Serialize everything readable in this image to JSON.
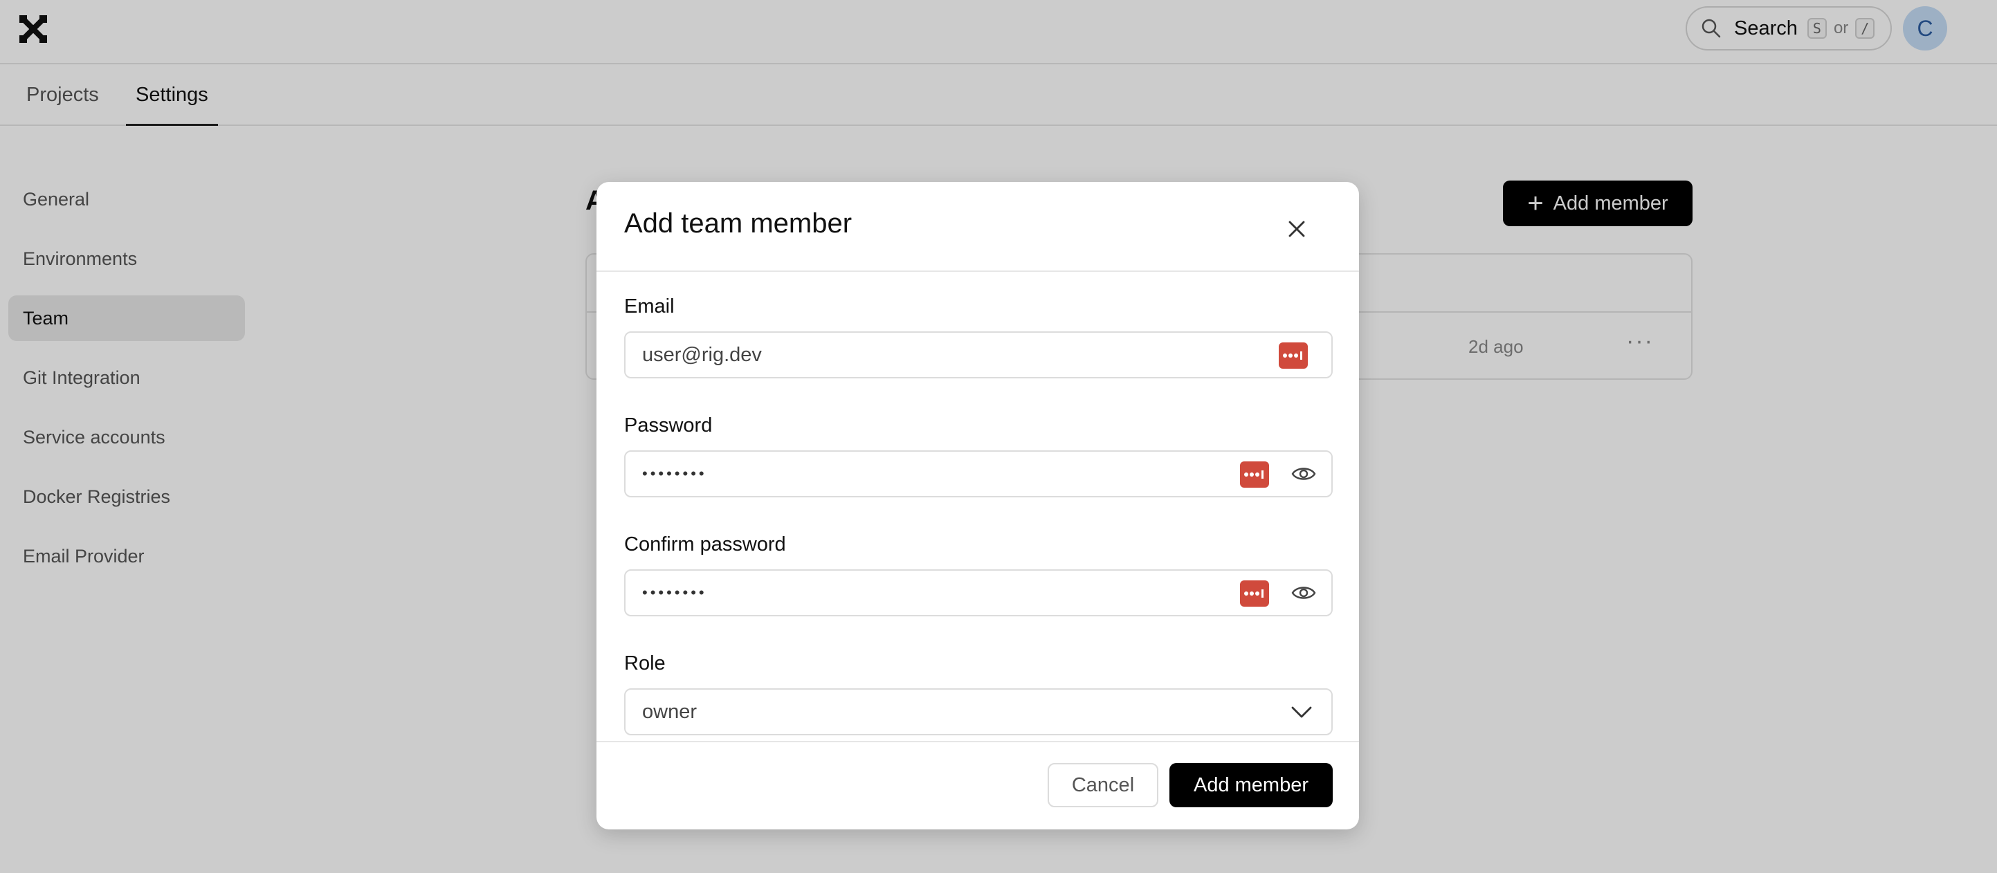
{
  "header": {
    "search_label": "Search",
    "search_key_1": "S",
    "search_or": "or",
    "search_key_2": "/",
    "avatar_initial": "C"
  },
  "tabs": [
    {
      "label": "Projects",
      "active": false
    },
    {
      "label": "Settings",
      "active": true
    }
  ],
  "sidebar": {
    "items": [
      {
        "label": "General"
      },
      {
        "label": "Environments"
      },
      {
        "label": "Team",
        "active": true
      },
      {
        "label": "Git Integration"
      },
      {
        "label": "Service accounts"
      },
      {
        "label": "Docker Registries"
      },
      {
        "label": "Email Provider"
      }
    ]
  },
  "main": {
    "heading_visible": "A",
    "add_member_label": "Add member",
    "row_time": "2d ago",
    "row_more": "···"
  },
  "modal": {
    "title": "Add team member",
    "email_label": "Email",
    "email_value": "user@rig.dev",
    "password_label": "Password",
    "password_value": "••••••••",
    "confirm_label": "Confirm password",
    "confirm_value": "••••••••",
    "role_label": "Role",
    "role_value": "owner",
    "cancel_label": "Cancel",
    "submit_label": "Add member"
  },
  "colors": {
    "primary": "#000000",
    "password_manager": "#d04a3c",
    "avatar_bg": "#c5dcf5"
  },
  "icons": {
    "logo": "rig-logo-icon",
    "search": "search-icon",
    "close": "close-icon",
    "password_manager": "password-manager-icon",
    "eye": "eye-icon",
    "chevron": "chevron-down-icon",
    "plus": "plus-icon"
  }
}
